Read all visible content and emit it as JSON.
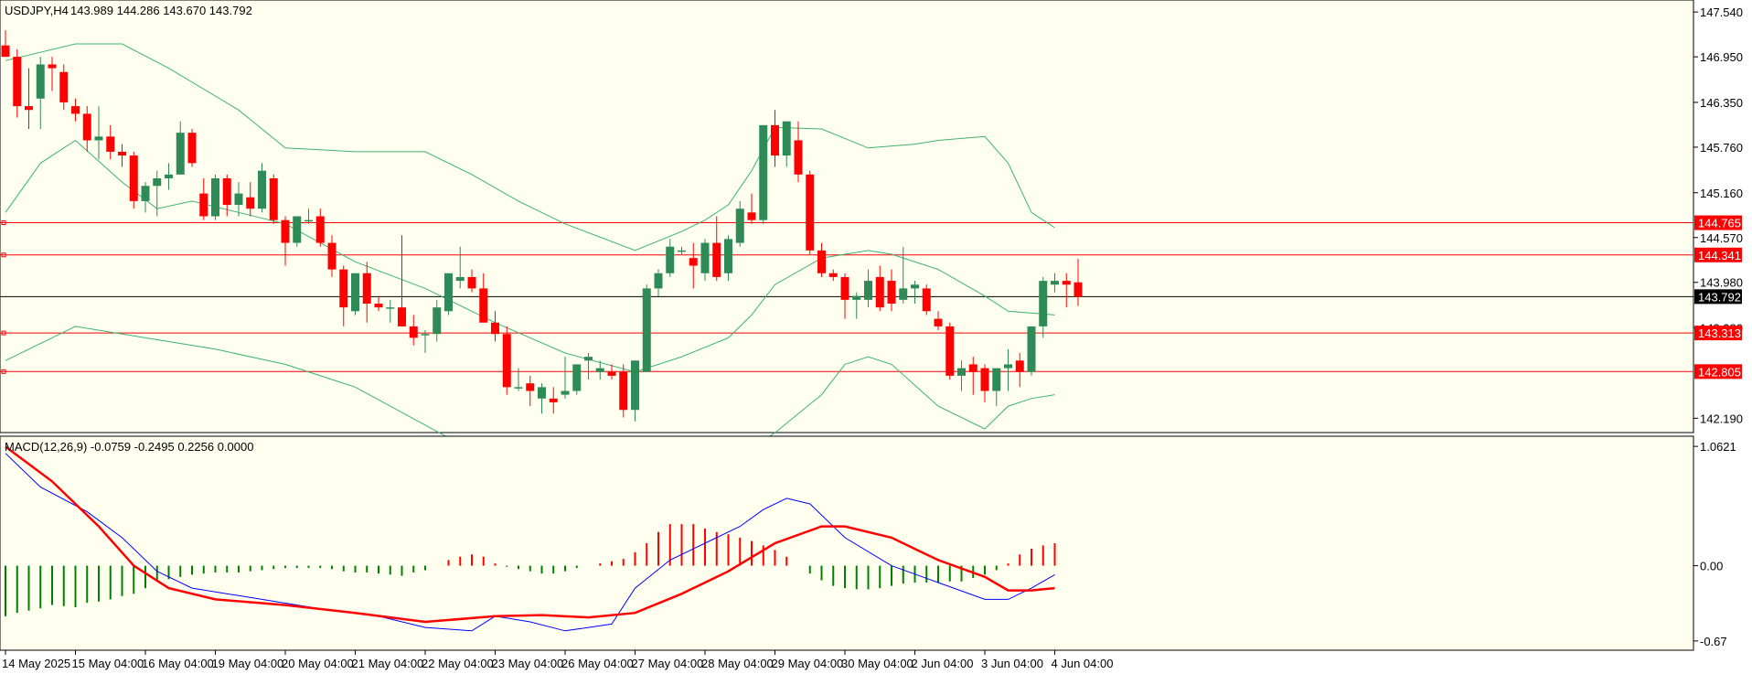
{
  "colors": {
    "background": "#FFFFF0",
    "frame": "#000000",
    "bull_candle": "#2E8B57",
    "bear_candle": "#FF0000",
    "bands": "#3CB371",
    "hline": "#FF0000",
    "current_line": "#000000",
    "macd_line": "#0000FF",
    "signal_line": "#FF0000",
    "hist_pos": "#FF0000",
    "hist_neg": "#008000"
  },
  "header": {
    "symbol_label": "USDJPY,H4",
    "ohlc": "143.989 144.286 143.670 143.792"
  },
  "macd_header": {
    "label": "MACD(12,26,9) -0.0759 -0.2495 0.2256 0.0000"
  },
  "price_axis": {
    "ticks": [
      "147.540",
      "146.950",
      "146.350",
      "145.760",
      "145.160",
      "144.570",
      "143.980",
      "143.380",
      "142.190"
    ],
    "tick_values": [
      147.54,
      146.95,
      146.35,
      145.76,
      145.16,
      144.57,
      143.98,
      143.38,
      142.19
    ],
    "range": [
      142.05,
      147.65
    ]
  },
  "macd_axis": {
    "ticks": [
      "1.0621",
      "0.00",
      "-0.67"
    ],
    "tick_values": [
      1.0621,
      0.0,
      -0.67
    ],
    "range": [
      -0.72,
      1.12
    ]
  },
  "level_tags": [
    {
      "label": "144.765",
      "value": 144.765,
      "kind": "level"
    },
    {
      "label": "144.341",
      "value": 144.341,
      "kind": "level"
    },
    {
      "label": "143.792",
      "value": 143.792,
      "kind": "current"
    },
    {
      "label": "143.313",
      "value": 143.313,
      "kind": "level"
    },
    {
      "label": "142.805",
      "value": 142.805,
      "kind": "level"
    }
  ],
  "time_axis": {
    "labels": [
      {
        "text": "14 May 2025",
        "bar": 0
      },
      {
        "text": "15 May 04:00",
        "bar": 6
      },
      {
        "text": "16 May 04:00",
        "bar": 12
      },
      {
        "text": "19 May 04:00",
        "bar": 18
      },
      {
        "text": "20 May 04:00",
        "bar": 24
      },
      {
        "text": "21 May 04:00",
        "bar": 30
      },
      {
        "text": "22 May 04:00",
        "bar": 36
      },
      {
        "text": "23 May 04:00",
        "bar": 42
      },
      {
        "text": "26 May 04:00",
        "bar": 48
      },
      {
        "text": "27 May 04:00",
        "bar": 54
      },
      {
        "text": "28 May 04:00",
        "bar": 60
      },
      {
        "text": "29 May 04:00",
        "bar": 66
      },
      {
        "text": "30 May 04:00",
        "bar": 72
      },
      {
        "text": "2 Jun 04:00",
        "bar": 78
      },
      {
        "text": "3 Jun 04:00",
        "bar": 84
      },
      {
        "text": "4 Jun 04:00",
        "bar": 90
      }
    ]
  },
  "chart_data": {
    "type": "candlestick",
    "symbol": "USDJPY",
    "timeframe": "H4",
    "candles": [
      [
        147.1,
        147.3,
        146.95,
        146.95
      ],
      [
        146.95,
        147.05,
        146.15,
        146.3
      ],
      [
        146.3,
        146.8,
        146.0,
        146.25
      ],
      [
        146.4,
        146.95,
        146.0,
        146.85
      ],
      [
        146.85,
        146.95,
        146.5,
        146.8
      ],
      [
        146.75,
        146.85,
        146.25,
        146.35
      ],
      [
        146.3,
        146.4,
        146.1,
        146.2
      ],
      [
        146.2,
        146.3,
        145.7,
        145.85
      ],
      [
        145.85,
        146.3,
        145.6,
        145.9
      ],
      [
        145.9,
        146.05,
        145.6,
        145.7
      ],
      [
        145.7,
        145.8,
        145.5,
        145.65
      ],
      [
        145.65,
        145.7,
        144.95,
        145.05
      ],
      [
        145.05,
        145.3,
        144.9,
        145.25
      ],
      [
        145.25,
        145.45,
        144.85,
        145.35
      ],
      [
        145.35,
        145.55,
        145.2,
        145.4
      ],
      [
        145.4,
        146.1,
        145.4,
        145.95
      ],
      [
        145.95,
        146.0,
        145.5,
        145.55
      ],
      [
        145.15,
        145.35,
        144.8,
        144.85
      ],
      [
        144.85,
        145.4,
        144.8,
        145.35
      ],
      [
        145.35,
        145.4,
        144.85,
        145.0
      ],
      [
        145.0,
        145.3,
        144.85,
        145.15
      ],
      [
        145.1,
        145.3,
        144.85,
        144.95
      ],
      [
        144.95,
        145.55,
        144.9,
        145.45
      ],
      [
        145.35,
        145.4,
        144.75,
        144.8
      ],
      [
        144.8,
        144.85,
        144.2,
        144.5
      ],
      [
        144.5,
        144.85,
        144.45,
        144.85
      ],
      [
        144.8,
        144.95,
        144.75,
        144.8
      ],
      [
        144.85,
        144.95,
        144.45,
        144.5
      ],
      [
        144.5,
        144.6,
        144.05,
        144.15
      ],
      [
        144.15,
        144.2,
        143.4,
        143.65
      ],
      [
        143.6,
        144.1,
        143.55,
        144.1
      ],
      [
        144.1,
        144.25,
        143.45,
        143.7
      ],
      [
        143.7,
        143.8,
        143.6,
        143.65
      ],
      [
        143.65,
        143.75,
        143.45,
        143.65
      ],
      [
        143.65,
        144.6,
        143.4,
        143.4
      ],
      [
        143.4,
        143.55,
        143.15,
        143.25
      ],
      [
        143.3,
        143.35,
        143.05,
        143.3
      ],
      [
        143.3,
        143.75,
        143.2,
        143.65
      ],
      [
        143.6,
        144.1,
        143.55,
        144.1
      ],
      [
        144.0,
        144.45,
        143.9,
        144.05
      ],
      [
        144.05,
        144.15,
        143.85,
        143.9
      ],
      [
        143.9,
        144.1,
        143.45,
        143.45
      ],
      [
        143.45,
        143.6,
        143.2,
        143.3
      ],
      [
        143.3,
        143.4,
        142.5,
        142.6
      ],
      [
        142.6,
        142.85,
        142.55,
        142.6
      ],
      [
        142.65,
        142.75,
        142.35,
        142.55
      ],
      [
        142.45,
        142.65,
        142.25,
        142.6
      ],
      [
        142.45,
        142.6,
        142.25,
        142.4
      ],
      [
        142.5,
        143.0,
        142.45,
        142.55
      ],
      [
        142.55,
        142.9,
        142.5,
        142.9
      ],
      [
        142.95,
        143.05,
        142.7,
        143.0
      ],
      [
        142.8,
        142.95,
        142.7,
        142.85
      ],
      [
        142.8,
        142.9,
        142.7,
        142.75
      ],
      [
        142.8,
        142.9,
        142.2,
        142.3
      ],
      [
        142.3,
        142.95,
        142.15,
        142.95
      ],
      [
        142.8,
        143.95,
        142.8,
        143.9
      ],
      [
        143.9,
        144.15,
        143.8,
        144.1
      ],
      [
        144.1,
        144.55,
        144.05,
        144.45
      ],
      [
        144.4,
        144.45,
        144.35,
        144.4
      ],
      [
        144.3,
        144.5,
        143.9,
        144.2
      ],
      [
        144.1,
        144.55,
        144.0,
        144.5
      ],
      [
        144.5,
        144.85,
        144.0,
        144.05
      ],
      [
        144.1,
        144.6,
        144.0,
        144.55
      ],
      [
        144.5,
        145.05,
        144.45,
        144.95
      ],
      [
        144.9,
        145.15,
        144.75,
        144.8
      ],
      [
        144.8,
        146.05,
        144.75,
        146.05
      ],
      [
        146.05,
        146.25,
        145.5,
        145.65
      ],
      [
        145.65,
        146.1,
        145.5,
        146.1
      ],
      [
        145.85,
        146.1,
        145.3,
        145.4
      ],
      [
        145.4,
        145.45,
        144.35,
        144.4
      ],
      [
        144.4,
        144.5,
        144.05,
        144.1
      ],
      [
        144.1,
        144.15,
        144.0,
        144.05
      ],
      [
        144.05,
        144.1,
        143.5,
        143.75
      ],
      [
        143.75,
        143.85,
        143.5,
        143.8
      ],
      [
        143.75,
        144.15,
        143.65,
        144.0
      ],
      [
        144.05,
        144.2,
        143.6,
        143.65
      ],
      [
        144.0,
        144.15,
        143.6,
        143.7
      ],
      [
        143.75,
        144.45,
        143.7,
        143.9
      ],
      [
        143.9,
        144.0,
        143.7,
        143.95
      ],
      [
        143.9,
        143.95,
        143.55,
        143.6
      ],
      [
        143.5,
        143.6,
        143.35,
        143.4
      ],
      [
        143.4,
        143.45,
        142.7,
        142.75
      ],
      [
        142.75,
        142.95,
        142.55,
        142.85
      ],
      [
        142.9,
        143.0,
        142.5,
        142.8
      ],
      [
        142.85,
        142.9,
        142.4,
        142.55
      ],
      [
        142.55,
        142.85,
        142.35,
        142.85
      ],
      [
        142.85,
        143.1,
        142.55,
        142.9
      ],
      [
        142.95,
        143.05,
        142.6,
        142.8
      ],
      [
        142.8,
        143.4,
        142.75,
        143.4
      ],
      [
        143.4,
        144.05,
        143.25,
        144.0
      ],
      [
        143.95,
        144.1,
        143.85,
        144.0
      ],
      [
        144.0,
        144.1,
        143.65,
        143.95
      ],
      [
        143.98,
        144.29,
        143.67,
        143.79
      ]
    ],
    "bands_upper": [
      [
        0,
        146.9
      ],
      [
        6,
        147.12
      ],
      [
        10,
        147.12
      ],
      [
        14,
        146.8
      ],
      [
        20,
        146.25
      ],
      [
        24,
        145.75
      ],
      [
        30,
        145.7
      ],
      [
        36,
        145.7
      ],
      [
        40,
        145.4
      ],
      [
        44,
        145.05
      ],
      [
        48,
        144.75
      ],
      [
        54,
        144.4
      ],
      [
        58,
        144.65
      ],
      [
        60,
        144.8
      ],
      [
        62,
        145.0
      ],
      [
        64,
        145.45
      ],
      [
        66,
        146.02
      ],
      [
        70,
        146.0
      ],
      [
        74,
        145.75
      ],
      [
        78,
        145.8
      ],
      [
        80,
        145.85
      ],
      [
        84,
        145.9
      ],
      [
        86,
        145.55
      ],
      [
        88,
        144.9
      ],
      [
        90,
        144.7
      ]
    ],
    "bands_middle": [
      [
        0,
        144.9
      ],
      [
        3,
        145.55
      ],
      [
        6,
        145.85
      ],
      [
        10,
        145.3
      ],
      [
        13,
        144.95
      ],
      [
        16,
        145.05
      ],
      [
        20,
        144.9
      ],
      [
        24,
        144.75
      ],
      [
        30,
        144.25
      ],
      [
        36,
        143.9
      ],
      [
        42,
        143.45
      ],
      [
        48,
        143.05
      ],
      [
        54,
        142.8
      ],
      [
        58,
        143.0
      ],
      [
        62,
        143.25
      ],
      [
        64,
        143.55
      ],
      [
        66,
        143.95
      ],
      [
        70,
        144.3
      ],
      [
        74,
        144.4
      ],
      [
        76,
        144.35
      ],
      [
        80,
        144.15
      ],
      [
        84,
        143.8
      ],
      [
        86,
        143.6
      ],
      [
        90,
        143.55
      ]
    ],
    "bands_lower": [
      [
        0,
        142.95
      ],
      [
        6,
        143.4
      ],
      [
        12,
        143.25
      ],
      [
        18,
        143.1
      ],
      [
        24,
        142.9
      ],
      [
        30,
        142.6
      ],
      [
        36,
        142.1
      ],
      [
        42,
        141.6
      ],
      [
        48,
        141.2
      ],
      [
        54,
        141.0
      ],
      [
        60,
        141.4
      ],
      [
        66,
        142.0
      ],
      [
        70,
        142.5
      ],
      [
        72,
        142.9
      ],
      [
        74,
        143.0
      ],
      [
        76,
        142.9
      ],
      [
        80,
        142.35
      ],
      [
        84,
        142.05
      ],
      [
        86,
        142.35
      ],
      [
        88,
        142.45
      ],
      [
        90,
        142.5
      ]
    ],
    "macd_main": [
      [
        0,
        1.0
      ],
      [
        3,
        0.7
      ],
      [
        7,
        0.48
      ],
      [
        10,
        0.25
      ],
      [
        13,
        -0.05
      ],
      [
        16,
        -0.2
      ],
      [
        22,
        -0.3
      ],
      [
        28,
        -0.4
      ],
      [
        32,
        -0.45
      ],
      [
        36,
        -0.55
      ],
      [
        40,
        -0.58
      ],
      [
        42,
        -0.45
      ],
      [
        45,
        -0.5
      ],
      [
        48,
        -0.58
      ],
      [
        52,
        -0.52
      ],
      [
        54,
        -0.2
      ],
      [
        57,
        0.05
      ],
      [
        60,
        0.2
      ],
      [
        63,
        0.35
      ],
      [
        65,
        0.5
      ],
      [
        67,
        0.6
      ],
      [
        69,
        0.55
      ],
      [
        72,
        0.25
      ],
      [
        76,
        0.0
      ],
      [
        80,
        -0.15
      ],
      [
        84,
        -0.3
      ],
      [
        86,
        -0.3
      ],
      [
        88,
        -0.2
      ],
      [
        90,
        -0.08
      ]
    ],
    "macd_signal": [
      [
        0,
        1.06
      ],
      [
        4,
        0.75
      ],
      [
        8,
        0.35
      ],
      [
        11,
        0.0
      ],
      [
        14,
        -0.2
      ],
      [
        18,
        -0.3
      ],
      [
        24,
        -0.35
      ],
      [
        30,
        -0.42
      ],
      [
        36,
        -0.5
      ],
      [
        42,
        -0.45
      ],
      [
        46,
        -0.44
      ],
      [
        50,
        -0.46
      ],
      [
        54,
        -0.42
      ],
      [
        58,
        -0.25
      ],
      [
        62,
        -0.05
      ],
      [
        66,
        0.2
      ],
      [
        70,
        0.35
      ],
      [
        72,
        0.35
      ],
      [
        76,
        0.25
      ],
      [
        80,
        0.05
      ],
      [
        84,
        -0.1
      ],
      [
        86,
        -0.22
      ],
      [
        88,
        -0.22
      ],
      [
        90,
        -0.2
      ]
    ],
    "macd_hist": [
      -0.45,
      -0.42,
      -0.4,
      -0.38,
      -0.35,
      -0.36,
      -0.37,
      -0.33,
      -0.32,
      -0.3,
      -0.27,
      -0.25,
      -0.2,
      -0.14,
      -0.12,
      -0.1,
      -0.08,
      -0.07,
      -0.06,
      -0.06,
      -0.06,
      -0.05,
      -0.04,
      -0.03,
      -0.02,
      -0.02,
      -0.02,
      -0.02,
      -0.03,
      -0.05,
      -0.06,
      -0.06,
      -0.07,
      -0.08,
      -0.09,
      -0.06,
      -0.04,
      0.0,
      0.05,
      0.08,
      0.1,
      0.08,
      0.02,
      -0.01,
      -0.03,
      -0.05,
      -0.07,
      -0.07,
      -0.05,
      -0.02,
      0.0,
      0.02,
      0.04,
      0.06,
      0.12,
      0.2,
      0.3,
      0.37,
      0.37,
      0.37,
      0.33,
      0.3,
      0.28,
      0.25,
      0.22,
      0.18,
      0.14,
      0.08,
      0.0,
      -0.07,
      -0.13,
      -0.18,
      -0.2,
      -0.21,
      -0.21,
      -0.2,
      -0.18,
      -0.16,
      -0.15,
      -0.15,
      -0.15,
      -0.14,
      -0.14,
      -0.11,
      -0.08,
      -0.04,
      0.02,
      0.1,
      0.15,
      0.18,
      0.2
    ]
  }
}
